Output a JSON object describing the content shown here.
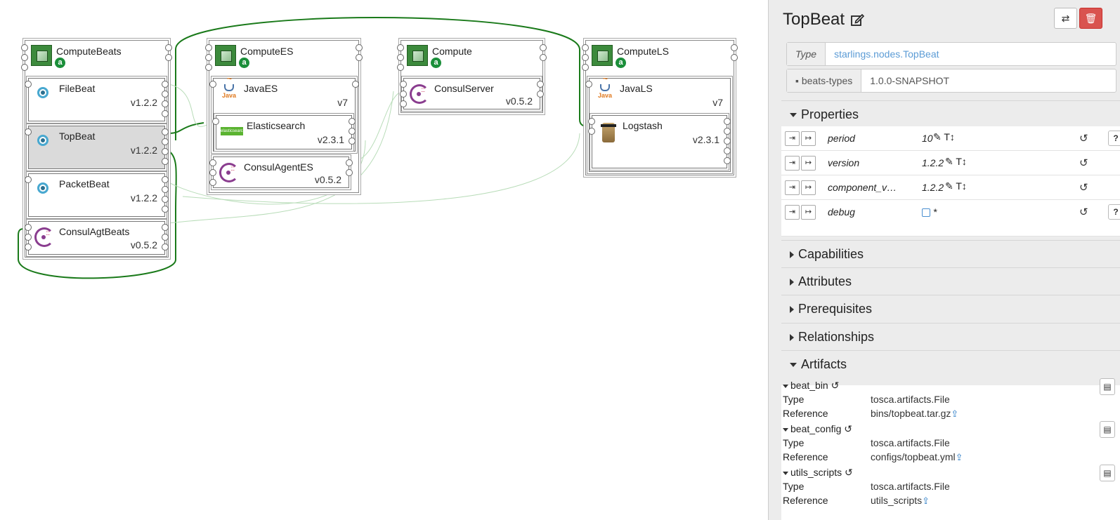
{
  "topology": {
    "computes": [
      {
        "name": "ComputeBeats",
        "badge": "a"
      },
      {
        "name": "ComputeES",
        "badge": "a"
      },
      {
        "name": "Compute",
        "badge": "a"
      },
      {
        "name": "ComputeLS",
        "badge": "a"
      }
    ],
    "nodes": [
      {
        "name": "FileBeat",
        "version": "v1.2.2",
        "icon": "beat-icon"
      },
      {
        "name": "TopBeat",
        "version": "v1.2.2",
        "icon": "beat-icon"
      },
      {
        "name": "PacketBeat",
        "version": "v1.2.2",
        "icon": "beat-icon"
      },
      {
        "name": "ConsulAgtBeats",
        "version": "v0.5.2",
        "icon": "consul-icon"
      },
      {
        "name": "JavaES",
        "version": "v7",
        "icon": "java-icon"
      },
      {
        "name": "Elasticsearch",
        "version": "v2.3.1",
        "icon": "elasticsearch-icon"
      },
      {
        "name": "ConsulAgentES",
        "version": "v0.5.2",
        "icon": "consul-icon"
      },
      {
        "name": "ConsulServer",
        "version": "v0.5.2",
        "icon": "consul-icon"
      },
      {
        "name": "JavaLS",
        "version": "v7",
        "icon": "java-icon"
      },
      {
        "name": "Logstash",
        "version": "v2.3.1",
        "icon": "logstash-icon"
      }
    ],
    "icon_labels": {
      "java": "Java",
      "elasticsearch": "elasticsearch"
    },
    "link_colors": {
      "hosted": "#1a7a1a",
      "depends": "#b8dcb8"
    }
  },
  "panel": {
    "title": "TopBeat",
    "type_label": "Type",
    "type_value": "starlings.nodes.TopBeat",
    "archive_label": "beats-types",
    "archive_version": "1.0.0-SNAPSHOT",
    "sections": {
      "properties": "Properties",
      "capabilities": "Capabilities",
      "attributes": "Attributes",
      "prerequisites": "Prerequisites",
      "relationships": "Relationships",
      "artifacts": "Artifacts"
    },
    "properties": [
      {
        "name": "period",
        "value": "10",
        "has_help": true
      },
      {
        "name": "version",
        "value": "1.2.2",
        "has_help": false
      },
      {
        "name": "component_ver...",
        "value": "1.2.2",
        "has_help": false
      },
      {
        "name": "debug",
        "value": "*",
        "has_help": true
      }
    ],
    "artifacts": [
      {
        "name": "beat_bin",
        "type_label": "Type",
        "type": "tosca.artifacts.File",
        "ref_label": "Reference",
        "reference": "bins/topbeat.tar.gz"
      },
      {
        "name": "beat_config",
        "type_label": "Type",
        "type": "tosca.artifacts.File",
        "ref_label": "Reference",
        "reference": "configs/topbeat.yml"
      },
      {
        "name": "utils_scripts",
        "type_label": "Type",
        "type": "tosca.artifacts.File",
        "ref_label": "Reference",
        "reference": "utils_scripts"
      }
    ],
    "accent": "#5b9bd5",
    "danger": "#d9534f"
  }
}
